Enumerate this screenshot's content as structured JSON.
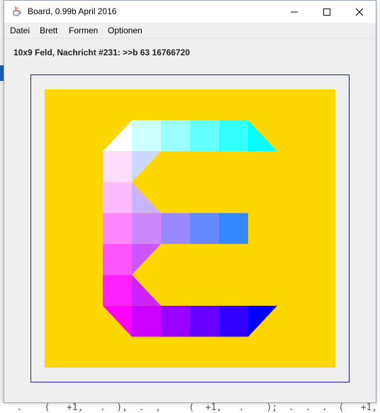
{
  "window": {
    "title": "Board, 0.99b April 2016",
    "icon": "java-coffee-cup-icon",
    "controls": {
      "minimize_icon": "minimize-icon",
      "maximize_icon": "maximize-icon",
      "close_icon": "close-icon"
    }
  },
  "menu": {
    "items": [
      {
        "label": "Datei"
      },
      {
        "label": "Brett"
      },
      {
        "label": "Formen"
      },
      {
        "label": "Optionen"
      }
    ]
  },
  "status": {
    "message": "10x9 Feld, Nachricht #231: >>b 63 16766720"
  },
  "board": {
    "columns": 10,
    "rows": 9,
    "background_color": "#FFD700",
    "frame_color": "#1C1CA8",
    "cells": [
      {
        "col": 2,
        "row": 1,
        "shape": "tri-bottom-right",
        "color": "#FFFFFF"
      },
      {
        "col": 3,
        "row": 1,
        "shape": "square",
        "color": "#CCFFFF"
      },
      {
        "col": 4,
        "row": 1,
        "shape": "square",
        "color": "#99FFFF"
      },
      {
        "col": 5,
        "row": 1,
        "shape": "square",
        "color": "#66FFFF"
      },
      {
        "col": 6,
        "row": 1,
        "shape": "square",
        "color": "#33FFFF"
      },
      {
        "col": 7,
        "row": 1,
        "shape": "tri-bottom-left",
        "color": "#00FFFF"
      },
      {
        "col": 2,
        "row": 2,
        "shape": "square",
        "color": "#FFDDFF"
      },
      {
        "col": 3,
        "row": 2,
        "shape": "tri-top-left",
        "color": "#CCD9FF"
      },
      {
        "col": 2,
        "row": 3,
        "shape": "square",
        "color": "#FFBBFF"
      },
      {
        "col": 3,
        "row": 3,
        "shape": "tri-bottom-left",
        "color": "#CCB3FF"
      },
      {
        "col": 2,
        "row": 4,
        "shape": "square",
        "color": "#FF88FF"
      },
      {
        "col": 3,
        "row": 4,
        "shape": "square",
        "color": "#CC88FF"
      },
      {
        "col": 4,
        "row": 4,
        "shape": "square",
        "color": "#9988FF"
      },
      {
        "col": 5,
        "row": 4,
        "shape": "square",
        "color": "#6688FF"
      },
      {
        "col": 6,
        "row": 4,
        "shape": "square",
        "color": "#3388FF"
      },
      {
        "col": 2,
        "row": 5,
        "shape": "square",
        "color": "#FF55FF"
      },
      {
        "col": 3,
        "row": 5,
        "shape": "tri-top-left",
        "color": "#CC55FF"
      },
      {
        "col": 2,
        "row": 6,
        "shape": "square",
        "color": "#FF22FF"
      },
      {
        "col": 3,
        "row": 6,
        "shape": "tri-bottom-left",
        "color": "#CC22FF"
      },
      {
        "col": 2,
        "row": 7,
        "shape": "tri-top-right",
        "color": "#FF00FF"
      },
      {
        "col": 3,
        "row": 7,
        "shape": "square",
        "color": "#CC00FF"
      },
      {
        "col": 4,
        "row": 7,
        "shape": "square",
        "color": "#9900FF"
      },
      {
        "col": 5,
        "row": 7,
        "shape": "square",
        "color": "#6600FF"
      },
      {
        "col": 6,
        "row": 7,
        "shape": "square",
        "color": "#3300FF"
      },
      {
        "col": 7,
        "row": 7,
        "shape": "tri-top-left",
        "color": "#0000FF"
      }
    ]
  },
  "background": {
    "bottom_code": "   .    (   +1,   .  ),  .  ,     (  +1,   .    );  .  .  .  (   +1,"
  }
}
